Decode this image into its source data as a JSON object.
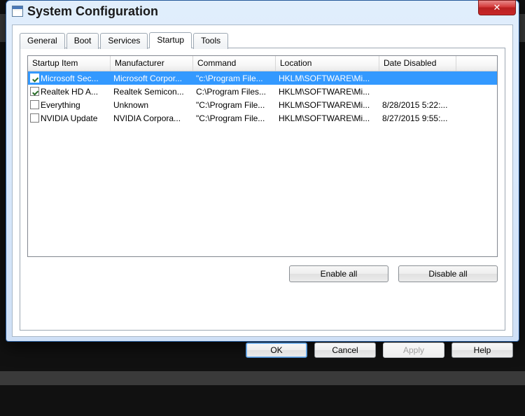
{
  "window": {
    "title": "System Configuration",
    "close": "✕"
  },
  "tabs": [
    "General",
    "Boot",
    "Services",
    "Startup",
    "Tools"
  ],
  "active_tab": 3,
  "columns": [
    "Startup Item",
    "Manufacturer",
    "Command",
    "Location",
    "Date Disabled"
  ],
  "rows": [
    {
      "checked": true,
      "selected": true,
      "item": "Microsoft Sec...",
      "mfr": "Microsoft Corpor...",
      "cmd": "\"c:\\Program File...",
      "loc": "HKLM\\SOFTWARE\\Mi...",
      "dis": ""
    },
    {
      "checked": true,
      "selected": false,
      "item": "Realtek HD A...",
      "mfr": "Realtek Semicon...",
      "cmd": "C:\\Program Files...",
      "loc": "HKLM\\SOFTWARE\\Mi...",
      "dis": ""
    },
    {
      "checked": false,
      "selected": false,
      "item": "Everything",
      "mfr": "Unknown",
      "cmd": "\"C:\\Program File...",
      "loc": "HKLM\\SOFTWARE\\Mi...",
      "dis": "8/28/2015 5:22:..."
    },
    {
      "checked": false,
      "selected": false,
      "item": "NVIDIA Update",
      "mfr": "NVIDIA Corpora...",
      "cmd": "\"C:\\Program File...",
      "loc": "HKLM\\SOFTWARE\\Mi...",
      "dis": "8/27/2015 9:55:..."
    }
  ],
  "buttons": {
    "enable_all": "Enable all",
    "disable_all": "Disable all",
    "ok": "OK",
    "cancel": "Cancel",
    "apply": "Apply",
    "help": "Help"
  }
}
